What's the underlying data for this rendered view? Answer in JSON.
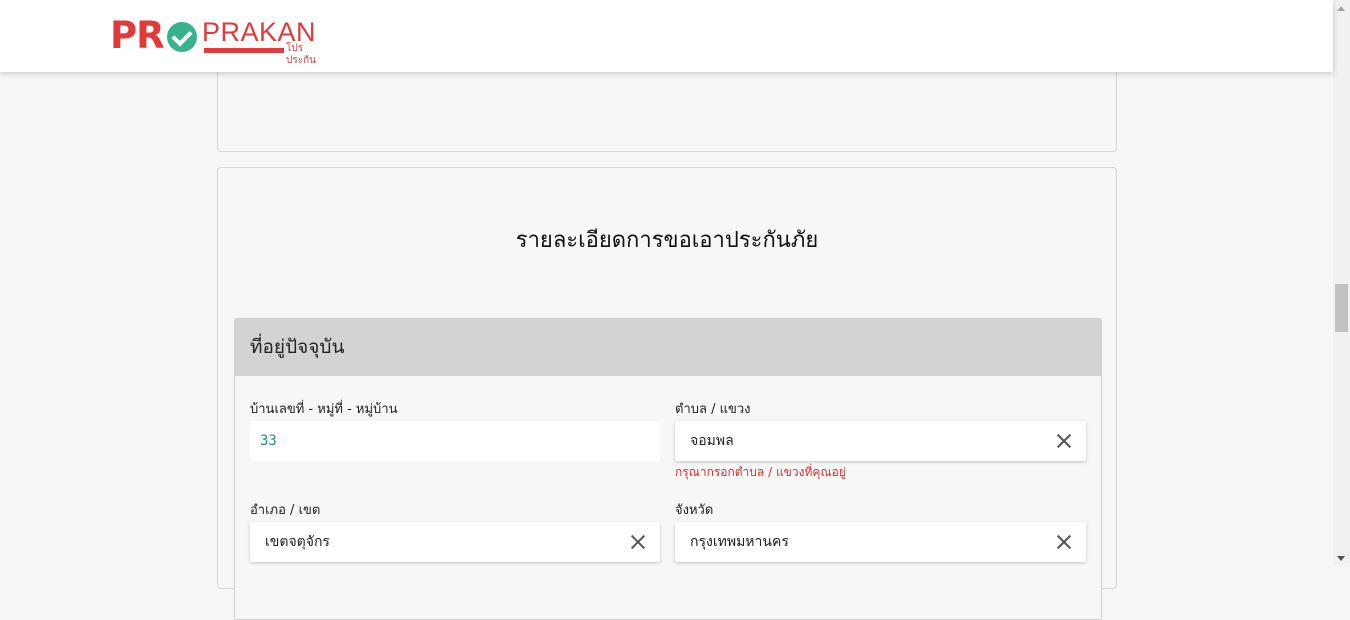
{
  "logo": {
    "pro": "PR",
    "prakan": "PRAKAN",
    "sub": "โปรประกัน",
    "icon": "check-circle-icon"
  },
  "form": {
    "title": "รายละเอียดการขอเอาประกันภัย",
    "section_title": "ที่อยู่ปัจจุบัน",
    "fields": [
      {
        "label": "บ้านเลขที่ - หมู่ที่ - หมู่บ้าน",
        "value": "33",
        "error": ""
      },
      {
        "label": "ตำบล / แขวง",
        "value": "จอมพล",
        "error": "กรุณากรอกตำบล / แขวงที่คุณอยู่"
      },
      {
        "label": "อำเภอ / เขต",
        "value": "เขตจตุจักร",
        "error": ""
      },
      {
        "label": "จังหวัด",
        "value": "กรุงเทพมหานคร",
        "error": ""
      }
    ]
  },
  "colors": {
    "brand_red": "#e03a3a",
    "brand_green": "#36b38a",
    "error_red": "#d32f2f",
    "value_teal": "#1f8f86"
  }
}
